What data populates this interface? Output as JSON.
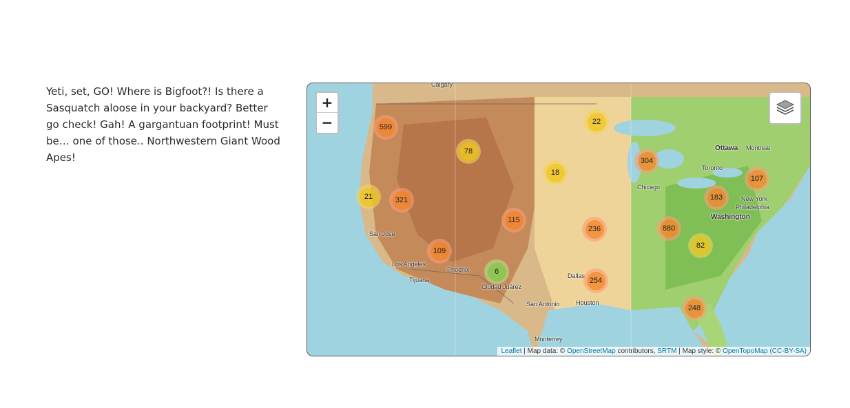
{
  "intro": {
    "text": "Yeti, set, GO! Where is Bigfoot?! Is there a Sasquatch aloose in your backyard? Better go check! Gah! A gargantuan footprint! Must be… one of those.. Northwestern Giant Wood Apes!"
  },
  "map": {
    "zoom_in_label": "+",
    "zoom_out_label": "−",
    "layers_icon": "layers-icon",
    "clusters": [
      {
        "count": "599",
        "size": "large"
      },
      {
        "count": "22",
        "size": "medium"
      },
      {
        "count": "78",
        "size": "medium"
      },
      {
        "count": "18",
        "size": "medium"
      },
      {
        "count": "304",
        "size": "large"
      },
      {
        "count": "107",
        "size": "large"
      },
      {
        "count": "21",
        "size": "medium"
      },
      {
        "count": "321",
        "size": "large"
      },
      {
        "count": "183",
        "size": "large"
      },
      {
        "count": "115",
        "size": "large"
      },
      {
        "count": "236",
        "size": "large"
      },
      {
        "count": "880",
        "size": "large"
      },
      {
        "count": "82",
        "size": "medium"
      },
      {
        "count": "109",
        "size": "large"
      },
      {
        "count": "6",
        "size": "small"
      },
      {
        "count": "254",
        "size": "large"
      },
      {
        "count": "248",
        "size": "large"
      }
    ],
    "places": [
      "Calgary",
      "Ottawa",
      "Montreal",
      "Toronto",
      "Chicago",
      "New York",
      "Philadelphia",
      "Washington",
      "San Jose",
      "Los Angeles",
      "Phoenix",
      "Tijuana",
      "Ciudad Juárez",
      "Dallas",
      "San Antonio",
      "Houston",
      "Monterrey"
    ],
    "attribution": {
      "leaflet": "Leaflet",
      "sep1": " | Map data: © ",
      "osm": "OpenStreetMap",
      "contrib": " contributors, ",
      "srtm": "SRTM",
      "style": " | Map style: © ",
      "otm": "OpenTopoMap",
      "license": "(CC-BY-SA)"
    }
  }
}
